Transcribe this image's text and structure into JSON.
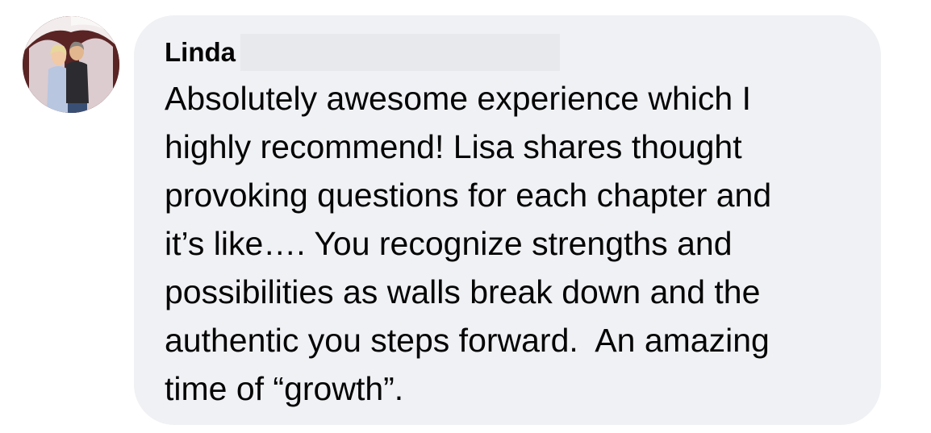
{
  "comment": {
    "author": "Linda",
    "lines": [
      "Absolutely awesome experience which I",
      "highly recommend! Lisa shares thought",
      "provoking questions for each chapter and",
      "it’s like…. You recognize strengths and",
      "possibilities as walls break down and the",
      "authentic you steps forward.  An amazing",
      "time of “growth”."
    ]
  },
  "colors": {
    "bubble_background": "#f0f1f4",
    "text": "#050505",
    "redaction": "#e8e9ec"
  },
  "icons": {
    "avatar": "profile-photo"
  }
}
